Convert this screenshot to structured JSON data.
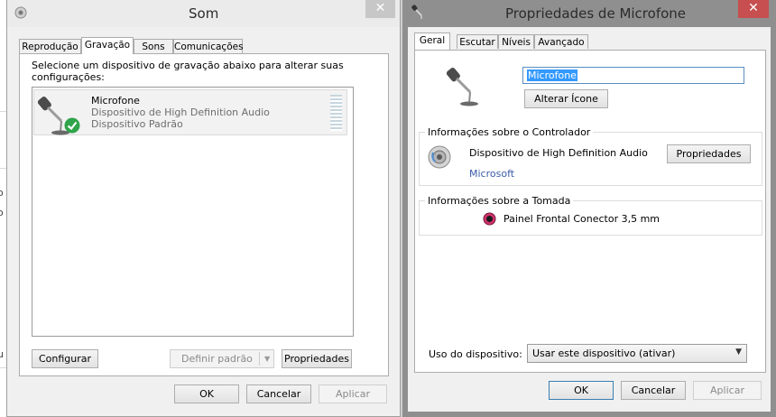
{
  "som": {
    "title": "Som",
    "close": "✕",
    "tabs": [
      "Reprodução",
      "Gravação",
      "Sons",
      "Comunicações"
    ],
    "instructions": [
      "Selecione um dispositivo de gravação abaixo para alterar suas",
      "configurações:"
    ],
    "device": {
      "name": "Microfone",
      "line1": "Dispositivo de High Definition Audio",
      "line2": "Dispositivo Padrão"
    },
    "buttons": {
      "configure": "Configurar",
      "set_default": "Definir padrão",
      "properties": "Propriedades",
      "ok": "OK",
      "cancel": "Cancelar",
      "apply": "Aplicar"
    }
  },
  "props": {
    "title": "Propriedades de Microfone",
    "close": "✕",
    "tabs": [
      "Geral",
      "Escutar",
      "Níveis",
      "Avançado"
    ],
    "name_value": "Microfone",
    "change_icon": "Alterar Ícone",
    "controller": {
      "heading": "Informações sobre o Controlador",
      "device": "Dispositivo de High Definition Audio",
      "vendor": "Microsoft",
      "properties": "Propriedades"
    },
    "jack": {
      "heading": "Informações sobre a Tomada",
      "value": "Painel Frontal Conector 3,5 mm"
    },
    "usage": {
      "label": "Uso do dispositivo:",
      "value": "Usar este dispositivo (ativar)"
    },
    "buttons": {
      "ok": "OK",
      "cancel": "Cancelar",
      "apply": "Aplicar"
    }
  },
  "background_edge": [
    "o",
    "o",
    "u"
  ],
  "colors": {
    "close_red": "#c74f4f",
    "accent_blue": "#3c7fb1",
    "link_blue": "#3a5da8",
    "check_green": "#2fa44a",
    "jack_pink": "#d0316c"
  }
}
